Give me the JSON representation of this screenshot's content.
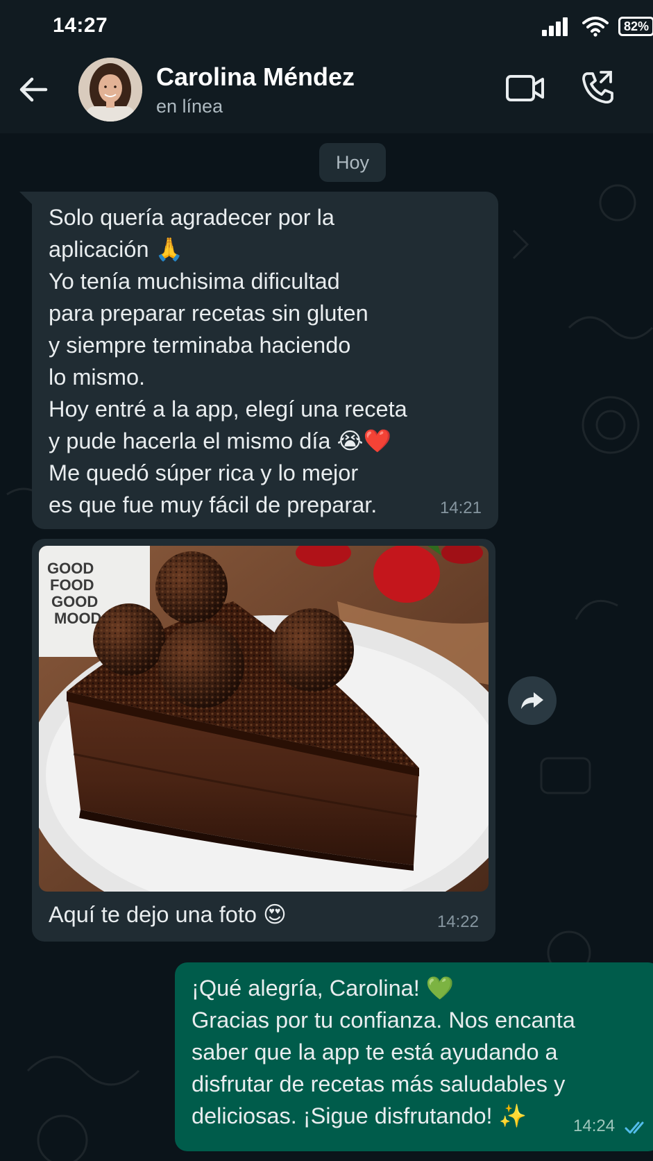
{
  "status_bar": {
    "time": "14:27",
    "battery": "82%",
    "icons": [
      "signal-icon",
      "wifi-icon",
      "battery-icon"
    ]
  },
  "header": {
    "back_icon": "back-arrow-icon",
    "contact_name": "Carolina Méndez",
    "contact_status": "en línea",
    "video_icon": "video-call-icon",
    "call_icon": "voice-call-icon"
  },
  "chat": {
    "date_separator": "Hoy",
    "messages": [
      {
        "direction": "incoming",
        "text": "Solo quería agradecer por la\naplicación 🙏\nYo tenía muchisima dificultad\npara preparar recetas sin gluten\ny siempre terminaba haciendo\nlo mismo.\nHoy entré a la app, elegí una receta\ny pude hacerla el mismo día 😭❤️\nMe quedó súper rica y lo mejor\nes que fue muy fácil de preparar.",
        "time": "14:21"
      },
      {
        "direction": "incoming",
        "type": "image",
        "image_description": "chocolate-cake-photo",
        "mug_text": "GOOD\nFOOD\nGOOD\nMOOD",
        "caption": "Aquí te dejo una foto 😍",
        "time": "14:22"
      },
      {
        "direction": "outgoing",
        "text": "¡Qué alegría, Carolina! 💚\nGracias por tu confianza. Nos encanta\nsaber que la app te está ayudando a\ndisfrutar de recetas más saludables y\ndeliciosas. ¡Sigue disfrutando! ✨",
        "time": "14:24",
        "status": "read"
      }
    ],
    "forward_icon": "forward-icon"
  },
  "colors": {
    "header_bg": "#111b21",
    "chat_bg": "#0b141a",
    "incoming_bubble": "#202c33",
    "outgoing_bubble": "#005c4b",
    "read_ticks": "#53bdeb",
    "muted_text": "#8696a0"
  }
}
